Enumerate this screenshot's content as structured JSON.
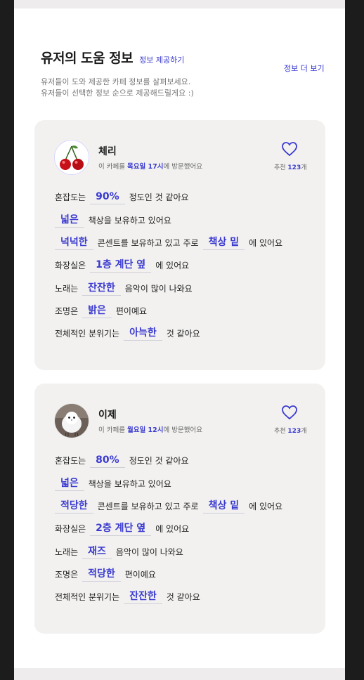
{
  "header": {
    "title": "유저의 도움 정보",
    "provide_link": "정보 제공하기",
    "more_link": "정보 더 보기",
    "desc_line1": "유저들이 도와 제공한 카페 정보를 살펴보세요.",
    "desc_line2": "유저들이 선택한 정보 순으로 제공해드릴게요 :)"
  },
  "cards": [
    {
      "user": "체리",
      "visit_prefix": "이 카페를 ",
      "visit_day": "목요일 17시",
      "visit_suffix": "에 방문했어요",
      "rec_prefix": "추천 ",
      "rec_count": "123",
      "rec_suffix": "개",
      "avatar_icon": "cherry-icon",
      "l1_pre": "혼잡도는",
      "l1_tag": "90%",
      "l1_post": "정도인 것 같아요",
      "l2_tag": "넓은",
      "l2_post": "책상을 보유하고 있어요",
      "l3_tag": "넉넉한",
      "l3_mid": "콘센트를 보유하고 있고 주로",
      "l3_tag2": "책상 밑",
      "l3_post": "에 있어요",
      "l4_pre": "화장실은",
      "l4_tag": "1층 계단 옆",
      "l4_post": "에 있어요",
      "l5_pre": "노래는",
      "l5_tag": "잔잔한",
      "l5_post": "음악이 많이 나와요",
      "l6_pre": "조명은",
      "l6_tag": "밝은",
      "l6_post": "편이예요",
      "l7_pre": "전체적인 분위기는",
      "l7_tag": "아늑한",
      "l7_post": "것 같아요"
    },
    {
      "user": "이제",
      "visit_prefix": "이 카페를 ",
      "visit_day": "월요일 12시",
      "visit_suffix": "에 방문했어요",
      "rec_prefix": "추천 ",
      "rec_count": "123",
      "rec_suffix": "개",
      "avatar_icon": "white-bird-icon",
      "l1_pre": "혼잡도는",
      "l1_tag": "80%",
      "l1_post": "정도인 것 같아요",
      "l2_tag": "넓은",
      "l2_post": "책상을 보유하고 있어요",
      "l3_tag": "적당한",
      "l3_mid": "콘센트를 보유하고 있고 주로",
      "l3_tag2": "책상 밑",
      "l3_post": "에 있어요",
      "l4_pre": "화장실은",
      "l4_tag": "2층 계단 옆",
      "l4_post": "에 있어요",
      "l5_pre": "노래는",
      "l5_tag": "재즈",
      "l5_post": "음악이 많이 나와요",
      "l6_pre": "조명은",
      "l6_tag": "적당한",
      "l6_post": "편이예요",
      "l7_pre": "전체적인 분위기는",
      "l7_tag": "잔잔한",
      "l7_post": "것 같아요"
    }
  ],
  "colors": {
    "accent": "#3a3ad0",
    "card_bg": "#f2f1f0",
    "frame": "#1c1c1c"
  }
}
